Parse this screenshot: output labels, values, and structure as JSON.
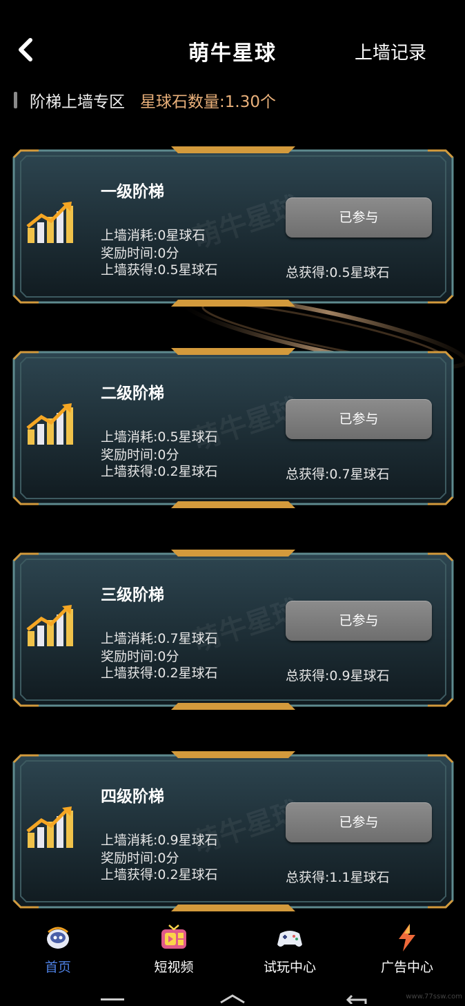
{
  "header": {
    "title": "萌牛星球",
    "record_link": "上墙记录"
  },
  "section": {
    "title": "阶梯上墙专区",
    "stone_label": "星球石数量:",
    "stone_value": "1.30个"
  },
  "cards": [
    {
      "title": "一级阶梯",
      "cost": "上墙消耗:0星球石",
      "time": "奖励时间:0分",
      "gain": "上墙获得:0.5星球石",
      "button": "已参与",
      "total": "总获得:0.5星球石"
    },
    {
      "title": "二级阶梯",
      "cost": "上墙消耗:0.5星球石",
      "time": "奖励时间:0分",
      "gain": "上墙获得:0.2星球石",
      "button": "已参与",
      "total": "总获得:0.7星球石"
    },
    {
      "title": "三级阶梯",
      "cost": "上墙消耗:0.7星球石",
      "time": "奖励时间:0分",
      "gain": "上墙获得:0.2星球石",
      "button": "已参与",
      "total": "总获得:0.9星球石"
    },
    {
      "title": "四级阶梯",
      "cost": "上墙消耗:0.9星球石",
      "time": "奖励时间:0分",
      "gain": "上墙获得:0.2星球石",
      "button": "已参与",
      "total": "总获得:1.1星球石"
    }
  ],
  "tabs": [
    {
      "label": "首页",
      "icon": "robot-mascot-icon",
      "active": true
    },
    {
      "label": "短视频",
      "icon": "tv-icon",
      "active": false
    },
    {
      "label": "试玩中心",
      "icon": "gamepad-icon",
      "active": false
    },
    {
      "label": "广告中心",
      "icon": "lightning-icon",
      "active": false
    }
  ],
  "watermark": "www.77ssw.com",
  "colors": {
    "accent": "#e9b07a",
    "active_tab": "#4d7fe0",
    "button": "#7d7d7d"
  }
}
